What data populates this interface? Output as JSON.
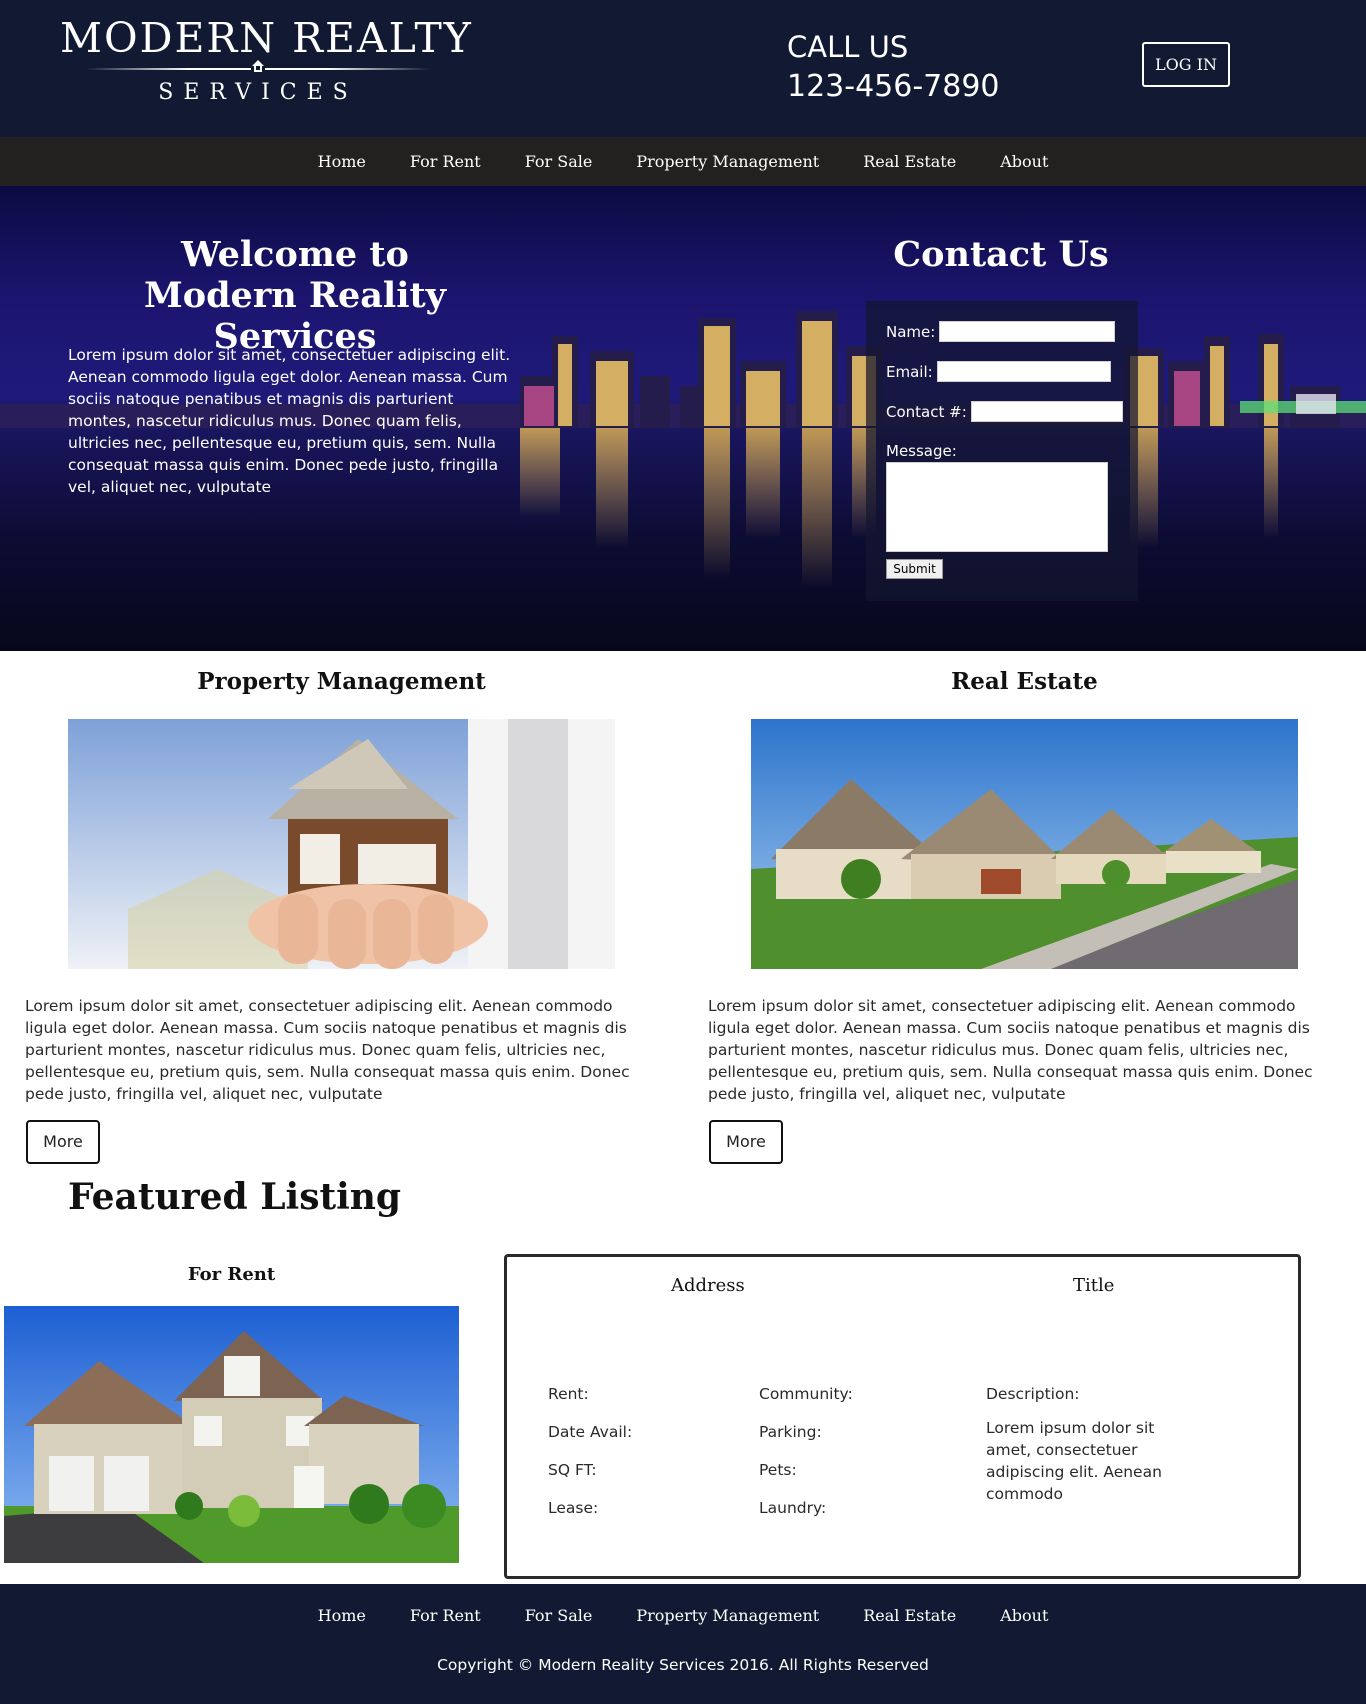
{
  "header": {
    "logo_line1": "MODERN REALTY",
    "logo_line2": "SERVICES",
    "call_label": "CALL US",
    "phone": "123-456-7890",
    "login_label": "LOG IN"
  },
  "nav": {
    "items": [
      {
        "label": "Home"
      },
      {
        "label": "For Rent"
      },
      {
        "label": "For Sale"
      },
      {
        "label": "Property Management"
      },
      {
        "label": "Real Estate"
      },
      {
        "label": "About"
      }
    ]
  },
  "hero": {
    "welcome_line1": "Welcome to",
    "welcome_line2": "Modern Reality Services",
    "welcome_text": "Lorem ipsum dolor sit amet, consectetuer adipiscing elit. Aenean commodo ligula eget dolor. Aenean massa. Cum sociis natoque penatibus et magnis dis parturient montes, nascetur ridiculus mus. Donec quam felis, ultricies nec, pellentesque eu, pretium quis, sem. Nulla consequat massa quis enim. Donec pede justo, fringilla vel, aliquet nec, vulputate",
    "contact_title": "Contact Us",
    "form": {
      "name_label": "Name:",
      "email_label": "Email:",
      "contact_label": "Contact #:",
      "message_label": "Message:",
      "name_value": "",
      "email_value": "",
      "contact_value": "",
      "message_value": "",
      "submit_label": "Submit"
    }
  },
  "services": {
    "pm": {
      "heading": "Property Management",
      "text": "Lorem ipsum dolor sit amet, consectetuer adipiscing elit. Aenean commodo ligula eget dolor. Aenean massa. Cum sociis natoque penatibus et magnis dis parturient montes, nascetur ridiculus mus. Donec quam felis, ultricies nec, pellentesque eu, pretium quis, sem. Nulla consequat massa quis enim. Donec pede justo, fringilla vel, aliquet nec, vulputate",
      "more_label": "More"
    },
    "re": {
      "heading": "Real Estate",
      "text": "Lorem ipsum dolor sit amet, consectetuer adipiscing elit. Aenean commodo ligula eget dolor. Aenean massa. Cum sociis natoque penatibus et magnis dis parturient montes, nascetur ridiculus mus. Donec quam felis, ultricies nec, pellentesque eu, pretium quis, sem. Nulla consequat massa quis enim. Donec pede justo, fringilla vel, aliquet nec, vulputate",
      "more_label": "More"
    }
  },
  "featured": {
    "title": "Featured Listing",
    "for_rent_heading": "For Rent",
    "address_heading": "Address",
    "title_heading": "Title",
    "labels": {
      "rent": "Rent:",
      "date_avail": "Date Avail:",
      "sqft": "SQ FT:",
      "lease": "Lease:",
      "community": "Community:",
      "parking": "Parking:",
      "pets": "Pets:",
      "laundry": "Laundry:",
      "description": "Description:"
    },
    "description_text": "Lorem ipsum dolor sit amet, consectetuer adipiscing elit. Aenean commodo"
  },
  "footer": {
    "copyright": "Copyright © Modern Reality Services 2016. All Rights Reserved"
  },
  "colors": {
    "header_bg": "#111a32",
    "nav_bg": "#22211f",
    "hero_sky": "#1c1570"
  }
}
